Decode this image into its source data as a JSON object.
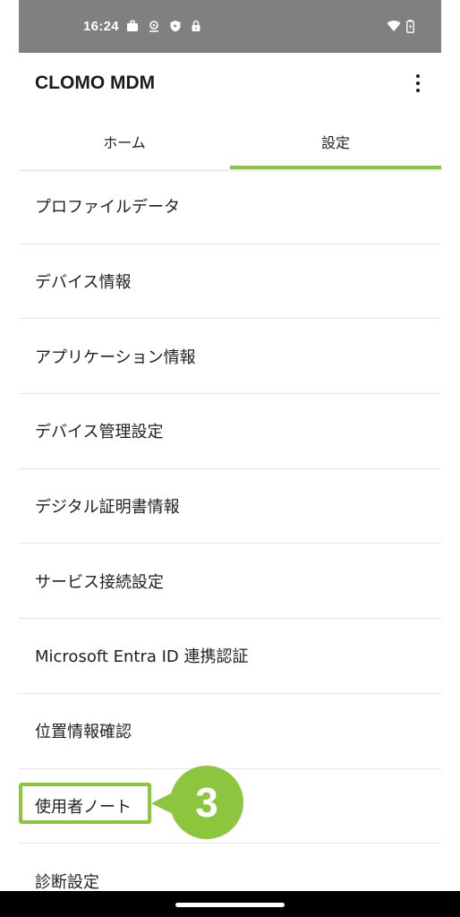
{
  "status_bar": {
    "time": "16:24",
    "left_icons": [
      "briefcase-icon",
      "location-icon",
      "shield-icon",
      "lock-icon"
    ],
    "right_icons": [
      "wifi-icon",
      "battery-icon"
    ]
  },
  "app_bar": {
    "title": "CLOMO MDM",
    "menu_icon": "more-vert-icon"
  },
  "tabs": [
    {
      "label": "ホーム",
      "active": false
    },
    {
      "label": "設定",
      "active": true
    }
  ],
  "settings_list": {
    "items": [
      {
        "label": "プロファイルデータ"
      },
      {
        "label": "デバイス情報"
      },
      {
        "label": "アプリケーション情報"
      },
      {
        "label": "デバイス管理設定"
      },
      {
        "label": "デジタル証明書情報"
      },
      {
        "label": "サービス接続設定"
      },
      {
        "label": "Microsoft Entra ID 連携認証"
      },
      {
        "label": "位置情報確認"
      },
      {
        "label": "使用者ノート"
      },
      {
        "label": "診断設定"
      }
    ]
  },
  "annotation": {
    "step_number": "3",
    "color": "#8cc63f"
  },
  "colors": {
    "accent": "#8cc63f",
    "status_bar": "#808080",
    "nav_bar": "#000000"
  }
}
